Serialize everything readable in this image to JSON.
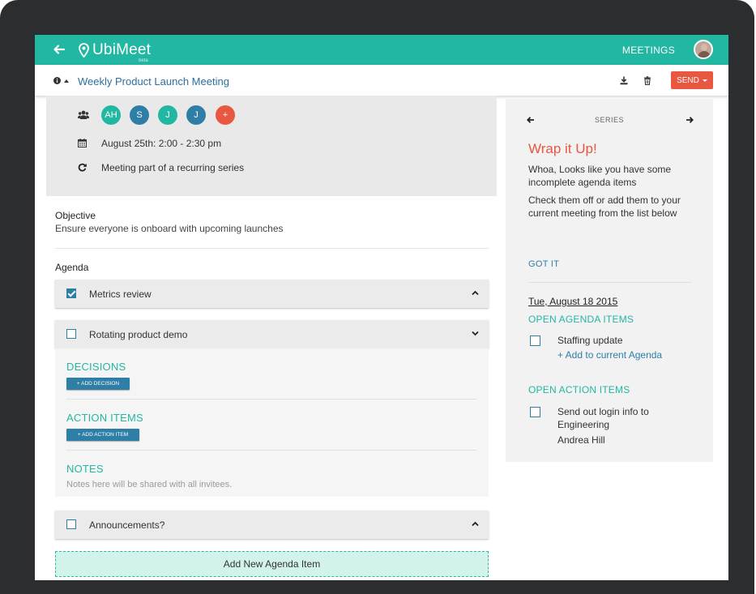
{
  "colors": {
    "brand": "#22b7a2",
    "send": "#e8573f",
    "link": "#2e7ea6"
  },
  "header": {
    "app_name": "UbiMeet",
    "beta": "beta",
    "nav_label": "MEETINGS"
  },
  "titlebar": {
    "meeting_title": "Weekly Product Launch Meeting",
    "send_label": "SEND"
  },
  "meta": {
    "attendees": [
      {
        "initials": "AH",
        "color": "#22b7a2"
      },
      {
        "initials": "S",
        "color": "#2e7ea6"
      },
      {
        "initials": "J",
        "color": "#22b7a2"
      },
      {
        "initials": "J",
        "color": "#2e7ea6"
      },
      {
        "initials": "+",
        "color": "#e8573f"
      }
    ],
    "date": "August 25th: 2:00 - 2:30 pm",
    "recurring": "Meeting part of a recurring series"
  },
  "objective": {
    "label": "Objective",
    "text": "Ensure everyone is onboard with upcoming launches"
  },
  "agenda": {
    "label": "Agenda",
    "items": [
      {
        "label": "Metrics review",
        "checked": true
      },
      {
        "label": "Rotating product demo",
        "checked": false
      },
      {
        "label": "Announcements?",
        "checked": false
      }
    ],
    "decisions_title": "DECISIONS",
    "add_decision": "+ ADD DECISION",
    "action_items_title": "ACTION ITEMS",
    "add_action_item": "+ ADD ACTION ITEM",
    "notes_title": "NOTES",
    "notes_placeholder": "Notes here will be shared with all invitees.",
    "add_new": "Add New Agenda Item"
  },
  "series_panel": {
    "label": "SERIES",
    "title": "Wrap it Up!",
    "text1": "Whoa, Looks like you have some incomplete agenda items",
    "text2": "Check them off or add them to your current meeting from the list below",
    "got_it": "GOT IT",
    "date": "Tue, August 18 2015",
    "open_agenda_title": "OPEN AGENDA ITEMS",
    "open_agenda_item": "Staffing update",
    "add_to_current": "+ Add to current Agenda",
    "open_action_title": "OPEN ACTION ITEMS",
    "open_action_item": "Send out login info to Engineering",
    "open_action_assignee": "Andrea Hill"
  }
}
